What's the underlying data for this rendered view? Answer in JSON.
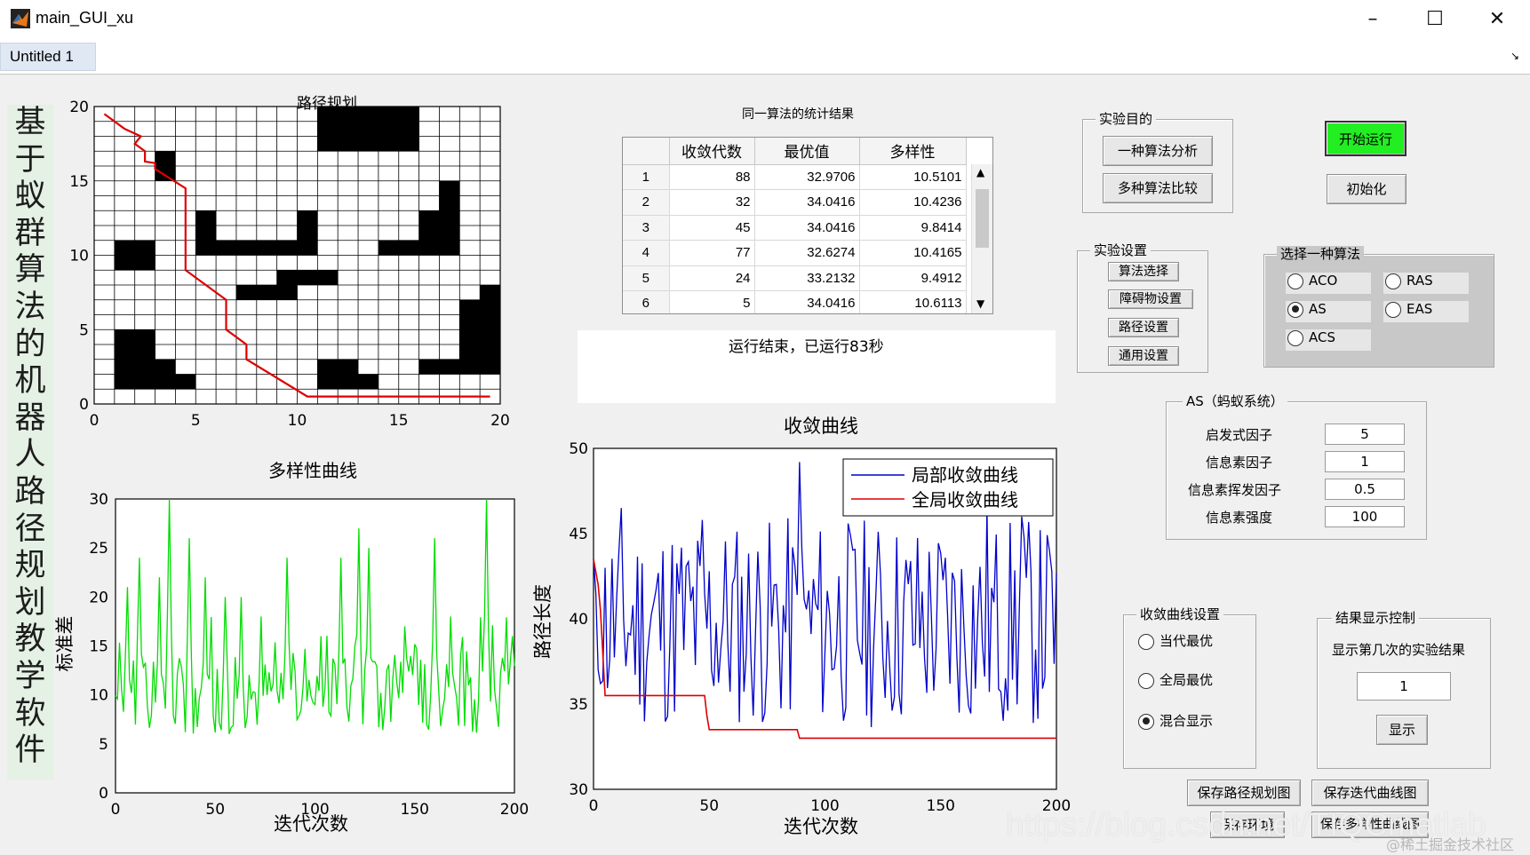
{
  "window": {
    "title": "main_GUI_xu",
    "tab": "Untitled 1",
    "dock_arrow": "↘",
    "controls": {
      "minimize": "–",
      "maximize": "☐",
      "close": "✕"
    }
  },
  "side_title": [
    "基",
    "于",
    "蚁",
    "群",
    "算",
    "法",
    "的",
    "机",
    "器",
    "人",
    "路",
    "径",
    "规",
    "划",
    "教",
    "学",
    "软",
    "件"
  ],
  "stats": {
    "title": "同一算法的统计结果",
    "columns": [
      "收敛代数",
      "最优值",
      "多样性"
    ],
    "rows": [
      {
        "id": "1",
        "gen": "88",
        "best": "32.9706",
        "div": "10.5101"
      },
      {
        "id": "2",
        "gen": "32",
        "best": "34.0416",
        "div": "10.4236"
      },
      {
        "id": "3",
        "gen": "45",
        "best": "34.0416",
        "div": "9.8414"
      },
      {
        "id": "4",
        "gen": "77",
        "best": "32.6274",
        "div": "10.4165"
      },
      {
        "id": "5",
        "gen": "24",
        "best": "33.2132",
        "div": "9.4912"
      },
      {
        "id": "6",
        "gen": "5",
        "best": "34.0416",
        "div": "10.6113"
      }
    ]
  },
  "status_text": "运行结束，已运行83秒",
  "purpose": {
    "title": "实验目的",
    "btn_single": "一种算法分析",
    "btn_multi": "多种算法比较"
  },
  "controls": {
    "start": "开始运行",
    "init": "初始化",
    "start_color": "#22ee22"
  },
  "settings": {
    "title": "实验设置",
    "items": [
      "算法选择",
      "障碍物设置",
      "路径设置",
      "通用设置"
    ]
  },
  "algo": {
    "title": "选择一种算法",
    "options": [
      {
        "label": "ACO",
        "selected": false
      },
      {
        "label": "RAS",
        "selected": false
      },
      {
        "label": "AS",
        "selected": true
      },
      {
        "label": "EAS",
        "selected": false
      },
      {
        "label": "ACS",
        "selected": false
      }
    ]
  },
  "as_params": {
    "title": "AS（蚂蚁系统）",
    "params": [
      {
        "label": "启发式因子",
        "value": "5"
      },
      {
        "label": "信息素因子",
        "value": "1"
      },
      {
        "label": "信息素挥发因子",
        "value": "0.5"
      },
      {
        "label": "信息素强度",
        "value": "100"
      }
    ]
  },
  "conv_settings": {
    "title": "收敛曲线设置",
    "options": [
      {
        "label": "当代最优",
        "selected": false
      },
      {
        "label": "全局最优",
        "selected": false
      },
      {
        "label": "混合显示",
        "selected": true
      }
    ]
  },
  "result_ctrl": {
    "title": "结果显示控制",
    "label": "显示第几次的实验结果",
    "value": "1",
    "button": "显示"
  },
  "save": {
    "path": "保存路径规划图",
    "iter": "保存迭代曲线图",
    "env": "保存环境",
    "div": "保存多样性曲线图"
  },
  "watermark": {
    "url": "https://blog.csdn.net/TIQCmatlab",
    "credit": "@稀土掘金技术社区"
  },
  "chart_data": [
    {
      "type": "grid-map",
      "title": "路径规划",
      "grid_size": 20,
      "xlim": [
        0,
        20
      ],
      "ylim": [
        0,
        20
      ],
      "xticks": [
        "0",
        "5",
        "10",
        "15",
        "20"
      ],
      "yticks": [
        "0",
        "5",
        "10",
        "15",
        "20"
      ],
      "path_color": "#dd0000",
      "obstacles": [
        [
          11,
          17,
          16,
          20
        ],
        [
          3,
          15,
          4,
          17
        ],
        [
          5,
          10,
          6,
          13
        ],
        [
          5,
          10,
          11,
          11
        ],
        [
          10,
          10,
          11,
          13
        ],
        [
          1,
          9,
          3,
          11
        ],
        [
          1,
          10,
          2,
          11
        ],
        [
          14,
          10,
          18,
          11
        ],
        [
          16,
          11,
          18,
          13
        ],
        [
          17,
          11,
          18,
          15
        ],
        [
          9,
          8,
          12,
          9
        ],
        [
          7,
          7,
          10,
          8
        ],
        [
          9,
          7,
          10,
          9
        ],
        [
          1,
          1,
          3,
          5
        ],
        [
          3,
          1,
          4,
          3
        ],
        [
          4,
          1,
          5,
          2
        ],
        [
          11,
          1,
          13,
          3
        ],
        [
          11,
          1,
          14,
          2
        ],
        [
          16,
          2,
          20,
          3
        ],
        [
          18,
          2,
          20,
          7
        ],
        [
          19,
          7,
          20,
          8
        ]
      ],
      "path": [
        [
          0.5,
          19.5
        ],
        [
          1.5,
          18.5
        ],
        [
          2.3,
          18
        ],
        [
          2,
          17.5
        ],
        [
          2.5,
          17
        ],
        [
          2.5,
          16.3
        ],
        [
          3,
          16.2
        ],
        [
          3,
          15.8
        ],
        [
          4.5,
          14.5
        ],
        [
          4.5,
          13.5
        ],
        [
          4.5,
          9
        ],
        [
          5.5,
          8
        ],
        [
          6.5,
          7
        ],
        [
          6.5,
          5
        ],
        [
          7.5,
          4
        ],
        [
          7.5,
          3
        ],
        [
          10.5,
          0.5
        ],
        [
          19.5,
          0.5
        ]
      ]
    },
    {
      "type": "line",
      "title": "多样性曲线",
      "xlabel": "迭代次数",
      "ylabel": "标准差",
      "xlim": [
        0,
        200
      ],
      "ylim": [
        0,
        30
      ],
      "xticks": [
        "0",
        "50",
        "100",
        "150",
        "200"
      ],
      "yticks": [
        "0",
        "5",
        "10",
        "15",
        "20",
        "25",
        "30"
      ],
      "series": [
        {
          "color": "#00dd00",
          "baseline": 10,
          "peaks": [
            [
              6,
              21
            ],
            [
              12,
              24
            ],
            [
              22,
              22
            ],
            [
              27,
              30
            ],
            [
              37,
              26
            ],
            [
              45,
              22
            ],
            [
              55,
              20
            ],
            [
              63,
              20
            ],
            [
              73,
              18
            ],
            [
              86,
              24
            ],
            [
              103,
              16
            ],
            [
              113,
              24
            ],
            [
              122,
              27
            ],
            [
              127,
              25
            ],
            [
              145,
              17
            ],
            [
              160,
              26
            ],
            [
              168,
              18
            ],
            [
              186,
              30
            ],
            [
              199,
              16
            ]
          ]
        }
      ]
    },
    {
      "type": "line",
      "title": "收敛曲线",
      "xlabel": "迭代次数",
      "ylabel": "路径长度",
      "xlim": [
        0,
        200
      ],
      "ylim": [
        30,
        50
      ],
      "xticks": [
        "0",
        "50",
        "100",
        "150",
        "200"
      ],
      "yticks": [
        "30",
        "35",
        "40",
        "45",
        "50"
      ],
      "legend_position": "top-right",
      "series": [
        {
          "name": "局部收敛曲线",
          "color": "#0000cc",
          "min": 32.9,
          "max": 47,
          "spikes": [
            [
              89,
              49.2
            ],
            [
              12,
              46.5
            ],
            [
              47,
              45.8
            ],
            [
              170,
              46.5
            ],
            [
              185,
              46
            ],
            [
              193,
              45.2
            ]
          ]
        },
        {
          "name": "全局收敛曲线",
          "color": "#dd0000",
          "steps": [
            [
              0,
              43.5
            ],
            [
              2,
              42
            ],
            [
              3,
              40.5
            ],
            [
              5,
              35.5
            ],
            [
              48,
              35.5
            ],
            [
              49,
              34.3
            ],
            [
              50,
              33.5
            ],
            [
              88,
              33.5
            ],
            [
              89,
              33
            ],
            [
              200,
              33
            ]
          ]
        }
      ]
    }
  ]
}
